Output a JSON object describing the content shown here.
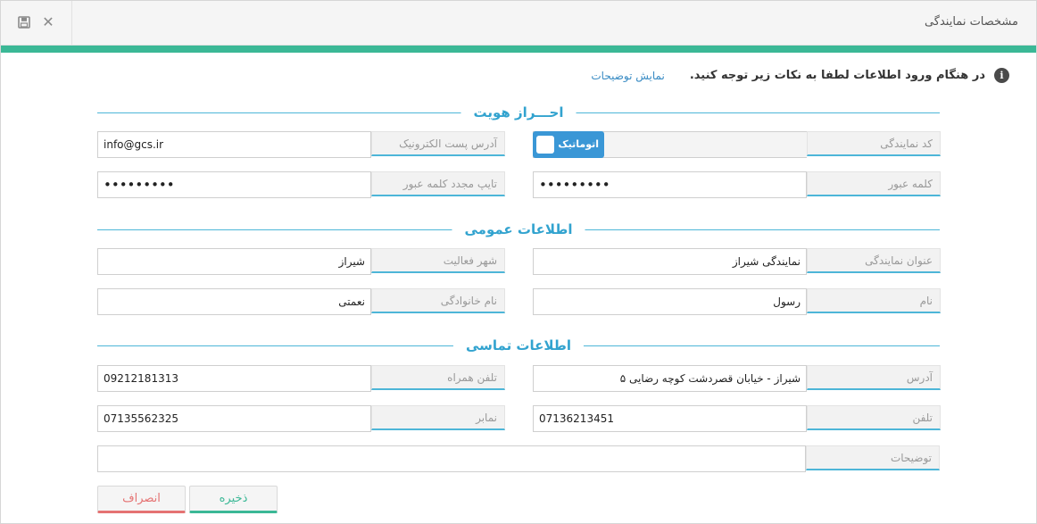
{
  "window": {
    "title": "مشخصات نمایندگی",
    "save_icon": "floppy-disk-icon",
    "close_icon": "close-icon",
    "close_glyph": "✕",
    "save_glyph": "💾"
  },
  "notice": {
    "icon": "info-icon",
    "icon_glyph": "i",
    "text": "در هنگام ورود اطلاعات لطفا به نکات زیر توجه کنید.",
    "link": "نمایش توضیحات"
  },
  "sections": {
    "identity": "احـــراز هویت",
    "general": "اطلاعات عمومی",
    "contact": "اطلاعات تماسی"
  },
  "identity": {
    "agency_code": {
      "label": "کد نمایندگی",
      "toggle_label": "اتوماتیک",
      "toggle_on": true
    },
    "email": {
      "label": "آدرس پست الکترونیک",
      "value": "info@gcs.ir"
    },
    "password": {
      "label": "کلمه عبور",
      "value": "•••••••••"
    },
    "password_confirm": {
      "label": "تایپ مجدد کلمه عبور",
      "value": "•••••••••"
    }
  },
  "general": {
    "agency_title": {
      "label": "عنوان نمایندگی",
      "value": "نمایندگی شیراز"
    },
    "activity_city": {
      "label": "شهر فعالیت",
      "value": "شیراز"
    },
    "first_name": {
      "label": "نام",
      "value": "رسول"
    },
    "last_name": {
      "label": "نام خانوادگی",
      "value": "نعمتی"
    }
  },
  "contact": {
    "address": {
      "label": "آدرس",
      "value": "شیراز - خیابان قصردشت کوچه رضایی ۵"
    },
    "mobile": {
      "label": "تلفن همراه",
      "value": "09212181313"
    },
    "phone": {
      "label": "تلفن",
      "value": "07136213451"
    },
    "fax": {
      "label": "نمابر",
      "value": "07135562325"
    },
    "description": {
      "label": "توضیحات",
      "value": ""
    }
  },
  "buttons": {
    "save": "ذخیره",
    "cancel": "انصراف"
  },
  "colors": {
    "accent_bar": "#3bb896",
    "section_title": "#32a3cf",
    "toggle": "#3a97d6",
    "save_button": "#3bb896",
    "cancel_button": "#e57373"
  }
}
